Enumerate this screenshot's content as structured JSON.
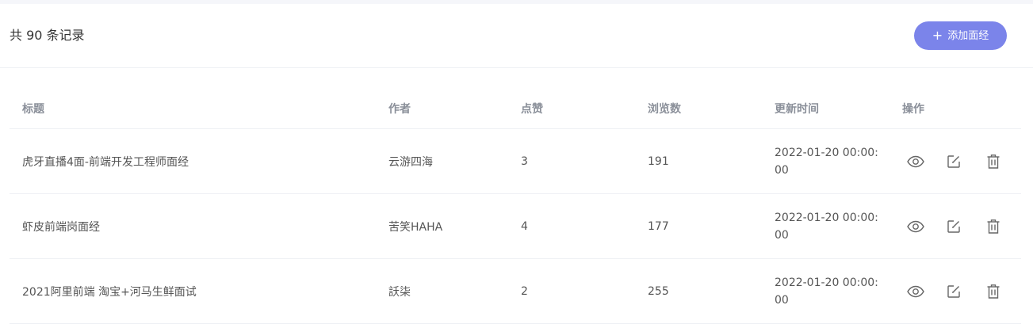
{
  "toolbar": {
    "total_text": "共 90 条记录",
    "add_button": {
      "plus": "+",
      "label": "添加面经",
      "color": "#7b84ea"
    }
  },
  "table": {
    "headers": [
      "标题",
      "作者",
      "点赞",
      "浏览数",
      "更新时间",
      "操作"
    ],
    "rows": [
      {
        "title": "虎牙直播4面-前端开发工程师面经",
        "author": "云游四海",
        "likes": "3",
        "views": "191",
        "updated": "2022-01-20 00:00:00"
      },
      {
        "title": "虾皮前端岗面经",
        "author": "苦笑HAHA",
        "likes": "4",
        "views": "177",
        "updated": "2022-01-20 00:00:00"
      },
      {
        "title": "2021阿里前端 淘宝+河马生鲜面试",
        "author": "訞柒",
        "likes": "2",
        "views": "255",
        "updated": "2022-01-20 00:00:00"
      }
    ],
    "actions": [
      "eye-icon",
      "edit-icon",
      "trash-icon"
    ]
  }
}
